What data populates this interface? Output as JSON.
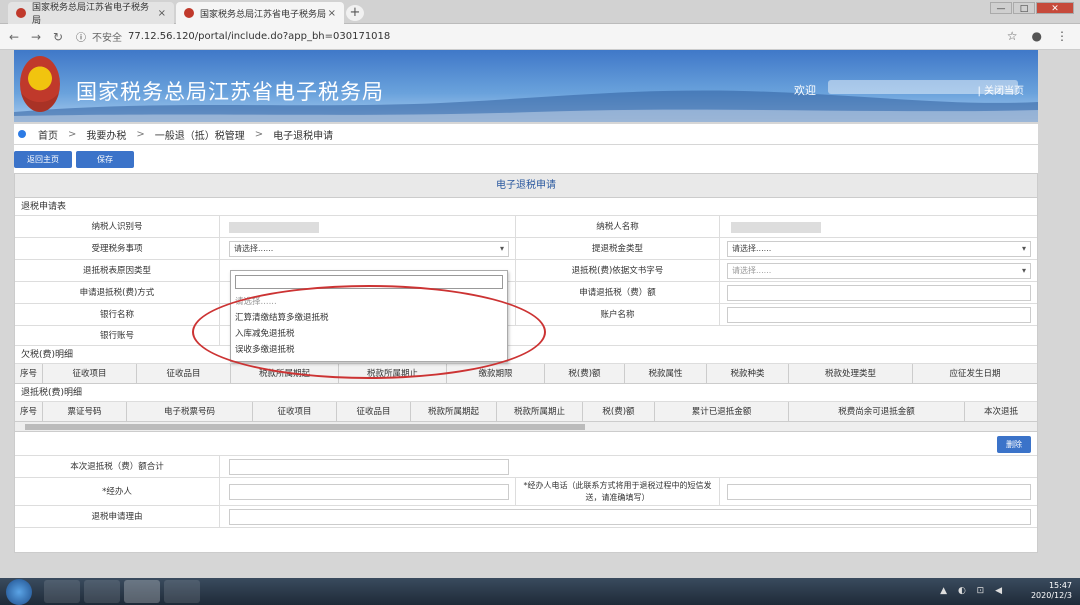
{
  "browser": {
    "tabs": [
      {
        "title": "国家税务总局江苏省电子税务局",
        "close": "×"
      },
      {
        "title": "国家税务总局江苏省电子税务局",
        "close": "×"
      }
    ],
    "new_tab": "+",
    "security": "不安全",
    "url": "77.12.56.120/portal/include.do?app_bh=030171018",
    "window_controls": {
      "minimize": "—",
      "maximize": "□",
      "close": "✕"
    }
  },
  "banner": {
    "title": "国家税务总局江苏省电子税务局",
    "welcome": "欢迎",
    "close_link": "| 关闭当页"
  },
  "breadcrumb": [
    "首页",
    "我要办税",
    "一般退（抵）税管理",
    "电子退税申请"
  ],
  "toolbar": {
    "back": "返回主页",
    "save": "保存"
  },
  "form": {
    "title": "电子退税申请",
    "section1": "退税申请表",
    "labels": {
      "taxpayer_id": "纳税人识别号",
      "taxpayer_name": "纳税人名称",
      "matter": "受理税务事项",
      "refund_type": "提退税金类型",
      "reason_type": "退抵税表原因类型",
      "doc_no": "退抵税(费)依据文书字号",
      "method": "申请退抵税(费)方式",
      "amount": "申请退抵税（费）额",
      "bank": "银行名称",
      "account_name": "账户名称",
      "account_no": "银行账号"
    },
    "placeholders": {
      "matter": "请选择......",
      "refund_type": "请选择......",
      "doc_no": "请选择......"
    },
    "section2": "欠税(费)明细",
    "owe_headers": [
      "序号",
      "征收项目",
      "征收品目",
      "税款所属期起",
      "税款所属期止",
      "缴款期限",
      "税(费)额",
      "税款属性",
      "税款种类",
      "税款处理类型",
      "应征发生日期"
    ],
    "section3": "退抵税(费)明细",
    "refund_headers": [
      "序号",
      "票证号码",
      "电子税票号码",
      "征收项目",
      "征收品目",
      "税款所属期起",
      "税款所属期止",
      "税(费)额",
      "累计已退抵金额",
      "税费尚余可退抵金额",
      "本次退抵"
    ],
    "delete_btn": "删除",
    "total_label": "本次退抵税（费）额合计",
    "handler_label": "*经办人",
    "phone_label": "*经办人电话（此联系方式将用于退税过程中的短信发送，请准确填写）",
    "reason_label": "退税申请理由"
  },
  "dropdown": {
    "items": [
      "请选择......",
      "汇算清缴结算多缴退抵税",
      "入库减免退抵税",
      "误收多缴退抵税"
    ]
  },
  "taskbar": {
    "time": "15:47",
    "date": "2020/12/3",
    "tray": "▲ ◐ ⊡ ◀"
  }
}
